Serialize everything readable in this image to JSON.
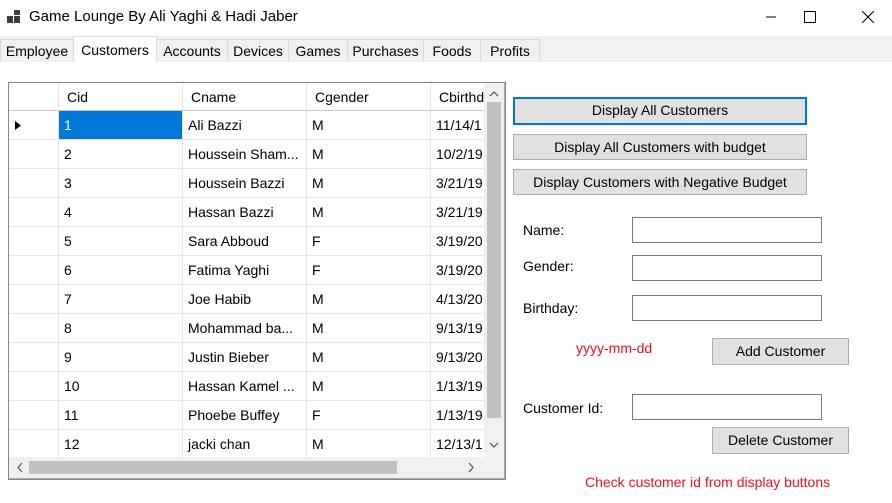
{
  "window": {
    "title": "Game Lounge By Ali Yaghi & Hadi Jaber"
  },
  "tabs": [
    {
      "label": "Employee"
    },
    {
      "label": "Customers"
    },
    {
      "label": "Accounts"
    },
    {
      "label": "Devices"
    },
    {
      "label": "Games"
    },
    {
      "label": "Purchases"
    },
    {
      "label": "Foods"
    },
    {
      "label": "Profits"
    }
  ],
  "grid": {
    "columns": [
      "Cid",
      "Cname",
      "Cgender",
      "Cbirthday"
    ],
    "rows": [
      {
        "cid": "1",
        "cname": "Ali Bazzi",
        "cgender": "M",
        "cbirth": "11/14/1"
      },
      {
        "cid": "2",
        "cname": "Houssein Sham...",
        "cgender": "M",
        "cbirth": "10/2/19"
      },
      {
        "cid": "3",
        "cname": "Houssein Bazzi",
        "cgender": "M",
        "cbirth": "3/21/19"
      },
      {
        "cid": "4",
        "cname": "Hassan Bazzi",
        "cgender": "M",
        "cbirth": "3/21/19"
      },
      {
        "cid": "5",
        "cname": "Sara Abboud",
        "cgender": "F",
        "cbirth": "3/19/20"
      },
      {
        "cid": "6",
        "cname": "Fatima Yaghi",
        "cgender": "F",
        "cbirth": "3/19/20"
      },
      {
        "cid": "7",
        "cname": "Joe Habib",
        "cgender": "M",
        "cbirth": "4/13/20"
      },
      {
        "cid": "8",
        "cname": "Mohammad ba...",
        "cgender": "M",
        "cbirth": "9/13/19"
      },
      {
        "cid": "9",
        "cname": "Justin Bieber",
        "cgender": "M",
        "cbirth": "9/13/20"
      },
      {
        "cid": "10",
        "cname": "Hassan Kamel ...",
        "cgender": "M",
        "cbirth": "1/13/19"
      },
      {
        "cid": "11",
        "cname": "Phoebe Buffey",
        "cgender": "F",
        "cbirth": "1/13/19"
      },
      {
        "cid": "12",
        "cname": "jacki chan",
        "cgender": "M",
        "cbirth": "12/13/1"
      }
    ]
  },
  "buttons": {
    "display_all": "Display All Customers",
    "display_budget": "Display All Customers with budget",
    "display_negative": "Display Customers with Negative Budget",
    "add_customer": "Add Customer",
    "delete_customer": "Delete Customer"
  },
  "form": {
    "name_label": "Name:",
    "gender_label": "Gender:",
    "birthday_label": "Birthday:",
    "date_hint": "yyyy-mm-dd",
    "customer_id_label": "Customer Id:",
    "name_value": "",
    "gender_value": "",
    "birthday_value": "",
    "customer_id_value": ""
  },
  "notes": {
    "check_hint": "Check customer id from display buttons"
  },
  "colors": {
    "selection": "#0078d7",
    "hint": "#e81123",
    "focus_border": "#0078d7"
  }
}
